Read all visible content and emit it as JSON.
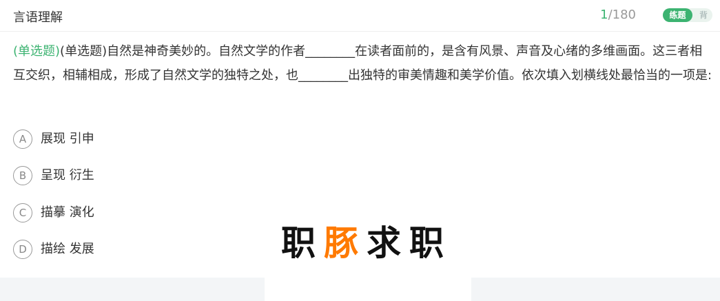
{
  "header": {
    "title": "言语理解",
    "progress_current": "1",
    "progress_total": "/180",
    "mode_active": "练题",
    "mode_inactive": "背"
  },
  "question": {
    "type_label": "(单选题)",
    "stem": "(单选题)自然是神奇美妙的。自然文学的作者________在读者面前的，是含有风景、声音及心绪的多维画面。这三者相互交织，相辅相成，形成了自然文学的独特之处，也________出独特的审美情趣和美学价值。依次填入划横线处最恰当的一项是:"
  },
  "options": [
    {
      "letter": "A",
      "text": "展现 引申"
    },
    {
      "letter": "B",
      "text": "呈现 衍生"
    },
    {
      "letter": "C",
      "text": "描摹 演化"
    },
    {
      "letter": "D",
      "text": "描绘 发展"
    }
  ],
  "watermark": {
    "part1": "职",
    "part2": "豚",
    "part3": "求职"
  },
  "colors": {
    "accent_green": "#3cb371",
    "watermark_orange": "#ff7a00"
  }
}
